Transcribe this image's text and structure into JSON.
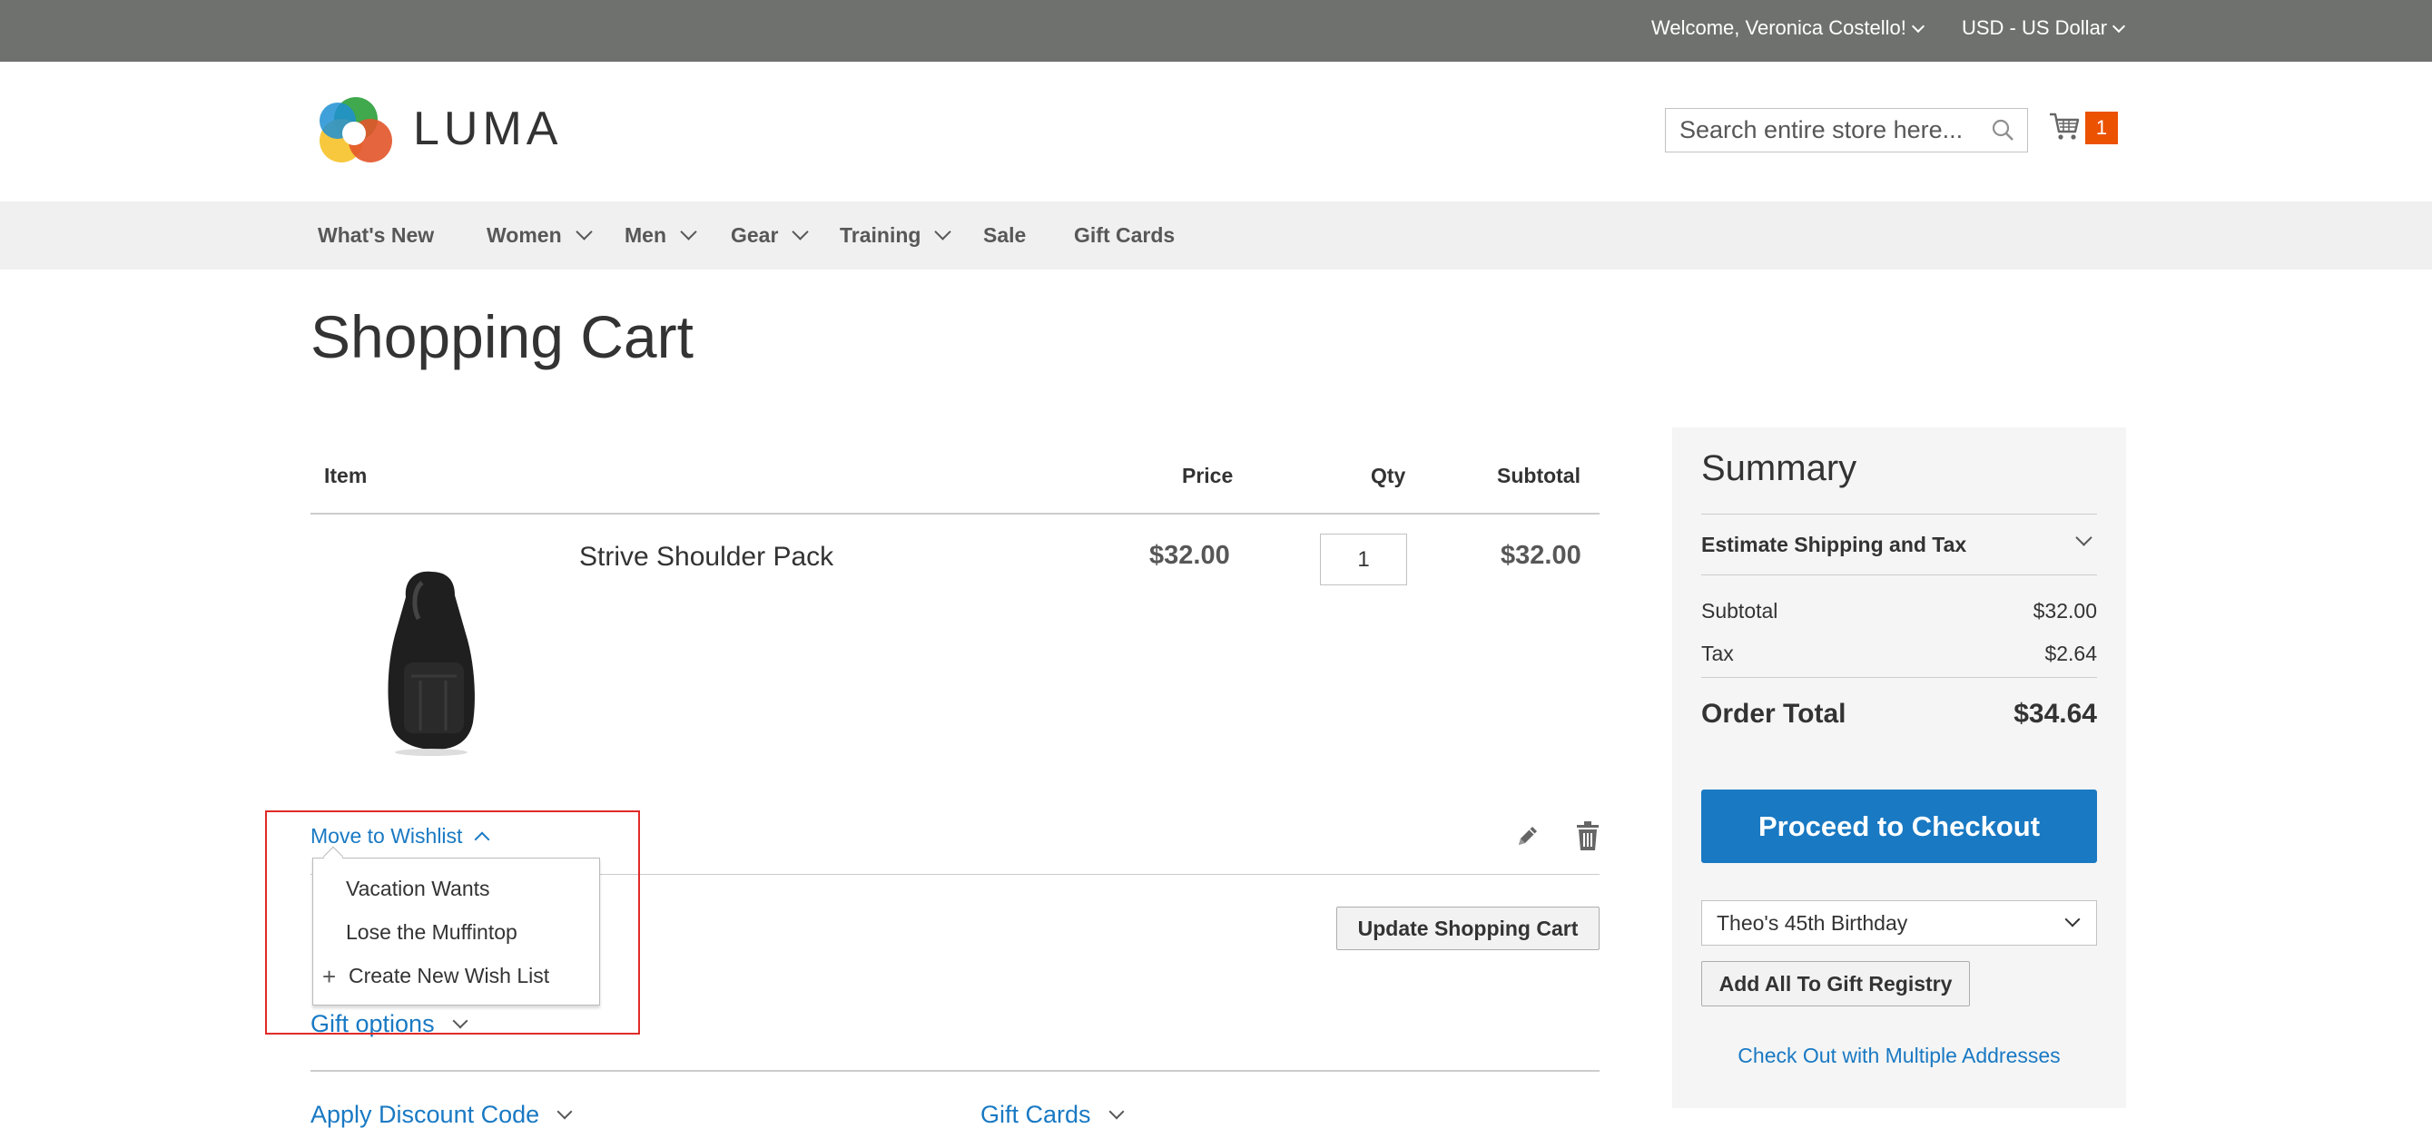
{
  "topbar": {
    "welcome": "Welcome, Veronica Costello!",
    "currency": "USD - US Dollar"
  },
  "header": {
    "logo_text": "LUMA",
    "search_placeholder": "Search entire store here...",
    "cart_count": "1"
  },
  "nav": {
    "items": [
      {
        "label": "What's New",
        "has_dropdown": false
      },
      {
        "label": "Women",
        "has_dropdown": true
      },
      {
        "label": "Men",
        "has_dropdown": true
      },
      {
        "label": "Gear",
        "has_dropdown": true
      },
      {
        "label": "Training",
        "has_dropdown": true
      },
      {
        "label": "Sale",
        "has_dropdown": false
      },
      {
        "label": "Gift Cards",
        "has_dropdown": false
      }
    ]
  },
  "page_title": "Shopping Cart",
  "cart": {
    "headers": {
      "item": "Item",
      "price": "Price",
      "qty": "Qty",
      "subtotal": "Subtotal"
    },
    "product": {
      "name": "Strive Shoulder Pack",
      "price": "$32.00",
      "qty": "1",
      "subtotal": "$32.00"
    },
    "move_to_wishlist": "Move to Wishlist",
    "wishlist_menu": [
      "Vacation Wants",
      "Lose the Muffintop",
      "Create New Wish List"
    ],
    "update_button": "Update Shopping Cart",
    "gift_options": "Gift options",
    "apply_discount": "Apply Discount Code",
    "gift_cards": "Gift Cards"
  },
  "summary": {
    "title": "Summary",
    "estimate": "Estimate Shipping and Tax",
    "subtotal_label": "Subtotal",
    "subtotal_value": "$32.00",
    "tax_label": "Tax",
    "tax_value": "$2.64",
    "total_label": "Order Total",
    "total_value": "$34.64",
    "checkout_button": "Proceed to Checkout",
    "registry_selected": "Theo's 45th Birthday",
    "registry_button": "Add All To Gift Registry",
    "multi_address": "Check Out with Multiple Addresses"
  },
  "colors": {
    "accent": "#1979c3",
    "cart_badge": "#eb5202",
    "topbar": "#6e716e",
    "highlight": "#e02b27"
  }
}
